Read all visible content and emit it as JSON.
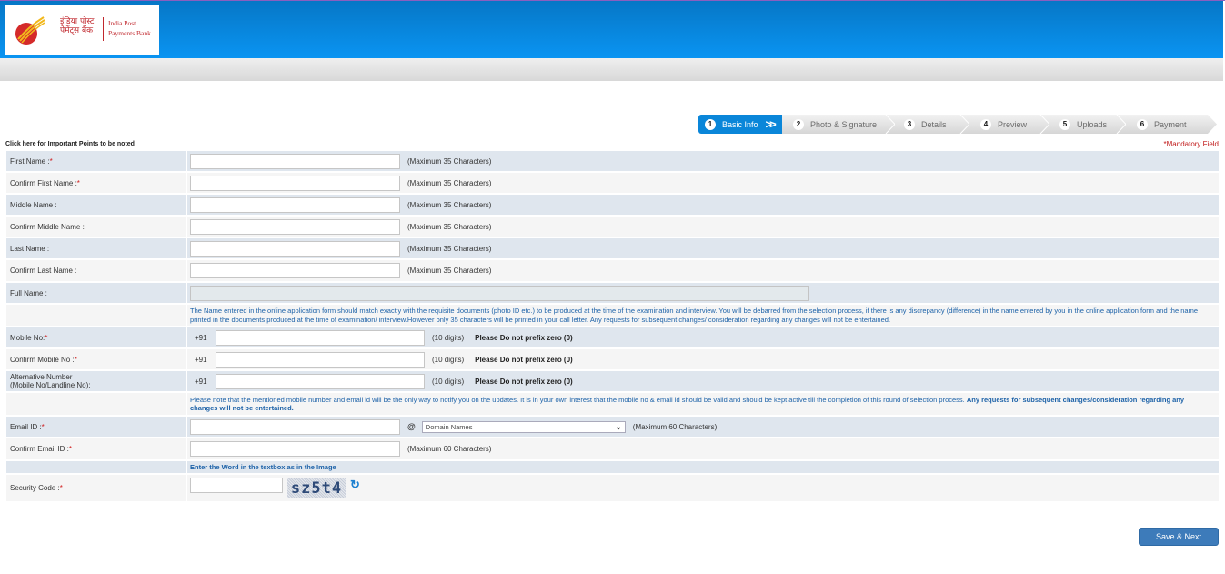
{
  "header": {
    "logo_hindi_line1": "इंडिया पोस्ट",
    "logo_hindi_line2": "पेमेंट्स बैंक",
    "logo_english_line1": "India Post",
    "logo_english_line2": "Payments Bank",
    "brand_color": "#0a94f2"
  },
  "steps": [
    {
      "num": "1",
      "label": "Basic Info",
      "active": true
    },
    {
      "num": "2",
      "label": "Photo & Signature",
      "active": false
    },
    {
      "num": "3",
      "label": "Details",
      "active": false
    },
    {
      "num": "4",
      "label": "Preview",
      "active": false
    },
    {
      "num": "5",
      "label": "Uploads",
      "active": false
    },
    {
      "num": "6",
      "label": "Payment",
      "active": false
    }
  ],
  "important_points_link": "Click here for Important Points to be noted",
  "mandatory_note": "*Mandatory Field",
  "form": {
    "first_name": {
      "label": "First Name : ",
      "required": "*",
      "value": "",
      "hint": "(Maximum 35 Characters)"
    },
    "confirm_first_name": {
      "label": "Confirm First Name : ",
      "required": "*",
      "value": "",
      "hint": "(Maximum 35 Characters)"
    },
    "middle_name": {
      "label": "Middle Name :",
      "value": "",
      "hint": "(Maximum 35 Characters)"
    },
    "confirm_middle_name": {
      "label": "Confirm Middle Name :",
      "value": "",
      "hint": "(Maximum 35 Characters)"
    },
    "last_name": {
      "label": "Last Name :",
      "value": "",
      "hint": "(Maximum 35 Characters)"
    },
    "confirm_last_name": {
      "label": "Confirm Last Name :",
      "value": "",
      "hint": "(Maximum 35 Characters)"
    },
    "full_name": {
      "label": "Full Name :",
      "value": ""
    },
    "name_note": "The Name entered in the online application form should match exactly with the requisite documents (photo ID etc.) to be produced at the time of the examination and interview. You will be debarred from the selection process, if there is any discrepancy (difference) in the name entered by you in the online application form and the name printed in the documents produced at the time of examination/ interview.However only 35 characters will be printed in your call letter. Any requests for subsequent changes/ consideration regarding any changes will not be entertained.",
    "mobile": {
      "label": "Mobile No:",
      "required": "*",
      "prefix": "+91",
      "value": "",
      "hint": "(10 digits)",
      "zero_note": "Please Do not prefix zero (0)"
    },
    "confirm_mobile": {
      "label": "Confirm Mobile No :",
      "required": "*",
      "prefix": "+91",
      "value": "",
      "hint": "(10 digits)",
      "zero_note": "Please Do not prefix zero (0)"
    },
    "alt_number": {
      "label_line1": "Alternative Number",
      "label_line2": "(Mobile No/Landline No):",
      "prefix": "+91",
      "value": "",
      "hint": "(10 digits)",
      "zero_note": "Please Do not prefix zero (0)"
    },
    "contact_note": "Please note that the mentioned mobile number and email id will be the only way to notify you on the updates. It is in your own interest that the mobile no & email id should be valid and should be kept active till the completion of this round of selection process. ",
    "contact_note_bold": "Any requests for subsequent changes/consideration regarding any changes will not be entertained.",
    "email": {
      "label": "Email ID :",
      "required": "*",
      "value": "",
      "at": "@",
      "domain_selected": "Domain Names",
      "hint": "(Maximum 60 Characters)"
    },
    "confirm_email": {
      "label": "Confirm Email ID : ",
      "required": "*",
      "value": "",
      "hint": "(Maximum 60 Characters)"
    },
    "captcha_note": "Enter the Word in the textbox as in the Image",
    "security_code": {
      "label": "Security Code :",
      "required": "*",
      "value": "",
      "captcha_text": "sz5t4"
    }
  },
  "save_button": "Save & Next"
}
